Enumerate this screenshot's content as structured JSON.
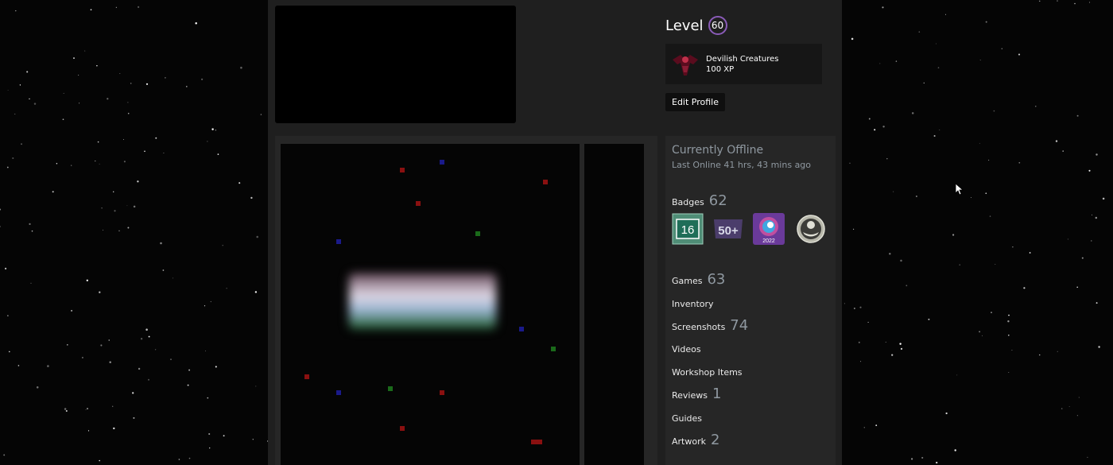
{
  "profile": {
    "level_label": "Level",
    "level_value": "60",
    "featured_badge": {
      "name": "Devilish Creatures",
      "xp": "100 XP",
      "icon": "devil-creature-icon"
    },
    "edit_profile_label": "Edit Profile"
  },
  "status": {
    "title": "Currently Offline",
    "last_online": "Last Online 41 hrs, 43 mins ago"
  },
  "badges": {
    "label": "Badges",
    "count": "62",
    "items": [
      {
        "icon": "years-of-service-badge-icon",
        "text": "16"
      },
      {
        "icon": "games-owned-badge-icon",
        "text": "50+"
      },
      {
        "icon": "steam-replay-badge-icon",
        "text": "2022"
      },
      {
        "icon": "community-badge-icon",
        "text": ""
      }
    ]
  },
  "links": {
    "games": {
      "label": "Games",
      "count": "63"
    },
    "inventory": {
      "label": "Inventory"
    },
    "screenshots": {
      "label": "Screenshots",
      "count": "74"
    },
    "videos": {
      "label": "Videos"
    },
    "workshop": {
      "label": "Workshop Items"
    },
    "reviews": {
      "label": "Reviews",
      "count": "1"
    },
    "guides": {
      "label": "Guides"
    },
    "artwork": {
      "label": "Artwork",
      "count": "2"
    }
  },
  "colors": {
    "background": "#050505",
    "panel": "#1f1f1f",
    "level_ring": "#8a5bb8",
    "muted_text": "#8f98a0"
  }
}
